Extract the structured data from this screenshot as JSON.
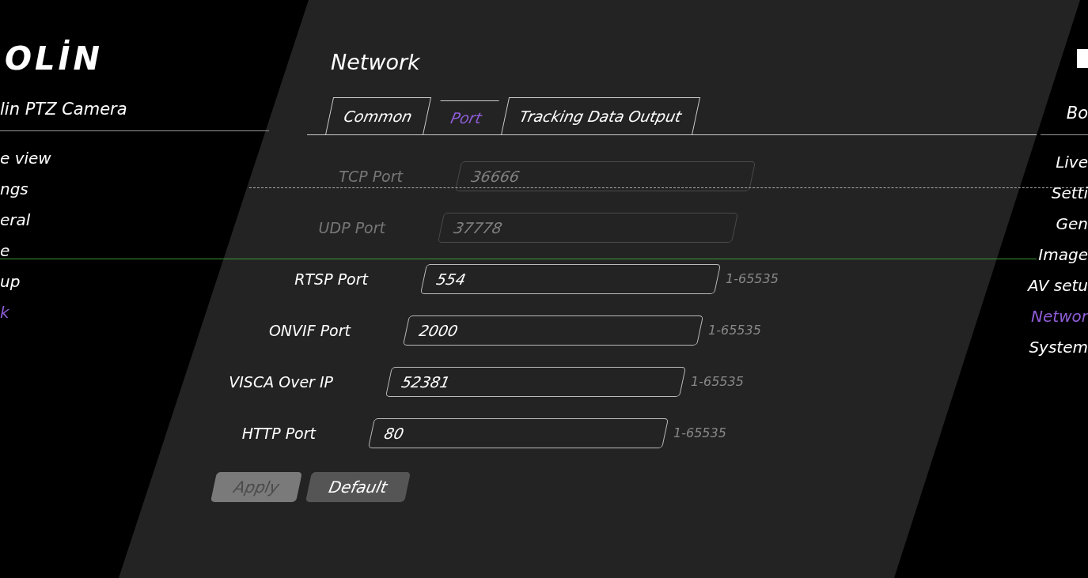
{
  "sidebar_left": {
    "logo": "OLİN",
    "title": "lin PTZ Camera",
    "items": [
      {
        "label": "e view",
        "selected": false
      },
      {
        "label": "ngs",
        "selected": false
      },
      {
        "label": "eral",
        "selected": false
      },
      {
        "label": "e",
        "selected": false
      },
      {
        "label": "up",
        "selected": false
      },
      {
        "label": "k",
        "selected": true
      }
    ]
  },
  "page": {
    "title": "Network",
    "tabs": [
      {
        "label": "Common",
        "selected": false
      },
      {
        "label": "Port",
        "selected": true
      },
      {
        "label": "Tracking Data Output",
        "selected": false
      }
    ],
    "fields": [
      {
        "label": "TCP Port",
        "value": "36666",
        "disabled": true
      },
      {
        "label": "UDP Port",
        "value": "37778",
        "disabled": true
      },
      {
        "label": "RTSP Port",
        "value": "554",
        "disabled": false,
        "hint": "1-65535"
      },
      {
        "label": "ONVIF Port",
        "value": "2000",
        "disabled": false,
        "hint": "1-65535"
      },
      {
        "label": "VISCA Over IP",
        "value": "52381",
        "disabled": false,
        "hint": "1-65535"
      },
      {
        "label": "HTTP Port",
        "value": "80",
        "disabled": false,
        "hint": "1-65535"
      }
    ],
    "buttons": [
      {
        "label": "Apply",
        "disabled": true
      },
      {
        "label": "Default",
        "disabled": false
      }
    ]
  },
  "sidebar_right": {
    "title": "Bo",
    "items": [
      {
        "label": "Live",
        "selected": false
      },
      {
        "label": "Setti",
        "selected": false
      },
      {
        "label": "Gen",
        "selected": false
      },
      {
        "label": "Image",
        "selected": false
      },
      {
        "label": "AV setu",
        "selected": false
      },
      {
        "label": "Networ",
        "selected": true
      },
      {
        "label": "System",
        "selected": false
      }
    ]
  }
}
